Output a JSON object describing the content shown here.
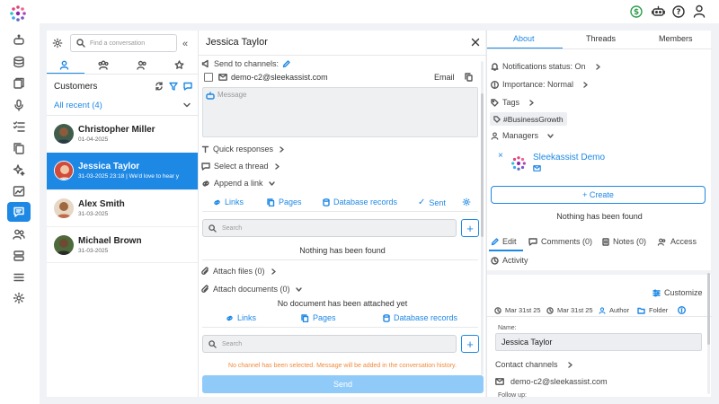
{
  "sidebar": {
    "items": [
      "chat-bot-icon",
      "database-icon",
      "documents-icon",
      "microphone-icon",
      "checklist-icon",
      "copy-icon",
      "sparkle-icon",
      "analytics-icon",
      "conversations-icon",
      "users-icon",
      "servers-icon",
      "menu-icon",
      "settings-icon"
    ],
    "active_index": 8
  },
  "topbar": {
    "icons": [
      "dollar-icon",
      "robot-icon",
      "help-icon",
      "user-icon"
    ]
  },
  "conversations": {
    "search_placeholder": "Find a conversation",
    "section_title": "Customers",
    "filter_label": "All recent (4)",
    "items": [
      {
        "name": "Christopher Miller",
        "sub": "01-04-2025",
        "avatar_color": "#8d5a3b"
      },
      {
        "name": "Jessica Taylor",
        "sub": "31-03-2025 23:18 | We'd love to hear y",
        "avatar_color": "#c75a3c"
      },
      {
        "name": "Alex Smith",
        "sub": "31-03-2025",
        "avatar_color": "#a0683f"
      },
      {
        "name": "Michael Brown",
        "sub": "31-03-2025",
        "avatar_color": "#5a4030"
      }
    ]
  },
  "chat": {
    "title": "Jessica Taylor",
    "send_to_channels": "Send to channels:",
    "channel_email": "demo-c2@sleekassist.com",
    "channel_type": "Email",
    "message_placeholder": "Message",
    "quick_responses": "Quick responses",
    "select_thread": "Select a thread",
    "append_link": "Append a link",
    "link_tabs": [
      "Links",
      "Pages",
      "Database records",
      "Sent"
    ],
    "search_placeholder": "Search",
    "nothing_found": "Nothing has been found",
    "attach_files": "Attach files (0)",
    "attach_documents": "Attach documents (0)",
    "no_document": "No document has been attached yet",
    "doc_tabs": [
      "Links",
      "Pages",
      "Database records"
    ],
    "search_placeholder_2": "Search",
    "warning": "No channel has been selected. Message will be added in the conversation history.",
    "send_label": "Send"
  },
  "details": {
    "tabs": [
      "About",
      "Threads",
      "Members"
    ],
    "notifications": "Notifications status: On",
    "importance": "Importance: Normal",
    "tags": "Tags",
    "tag_value": "#BusinessGrowth",
    "managers": "Managers",
    "manager_name": "Sleekassist Demo",
    "create_label": "+ Create",
    "nothing_found": "Nothing has been found",
    "section_tabs": [
      "Edit",
      "Comments (0)",
      "Notes (0)",
      "Access"
    ],
    "activity": "Activity",
    "customize": "Customize",
    "meta": [
      "Mar 31st 25",
      "Mar 31st 25",
      "Author",
      "Folder"
    ],
    "name_label": "Name:",
    "name_value": "Jessica Taylor",
    "contact_channels": "Contact channels",
    "contact_email": "demo-c2@sleekassist.com",
    "follow_up": "Follow up:"
  },
  "colors": {
    "accent": "#1e88e5",
    "warning": "#f08a3c",
    "send_disabled": "#90caf9"
  }
}
